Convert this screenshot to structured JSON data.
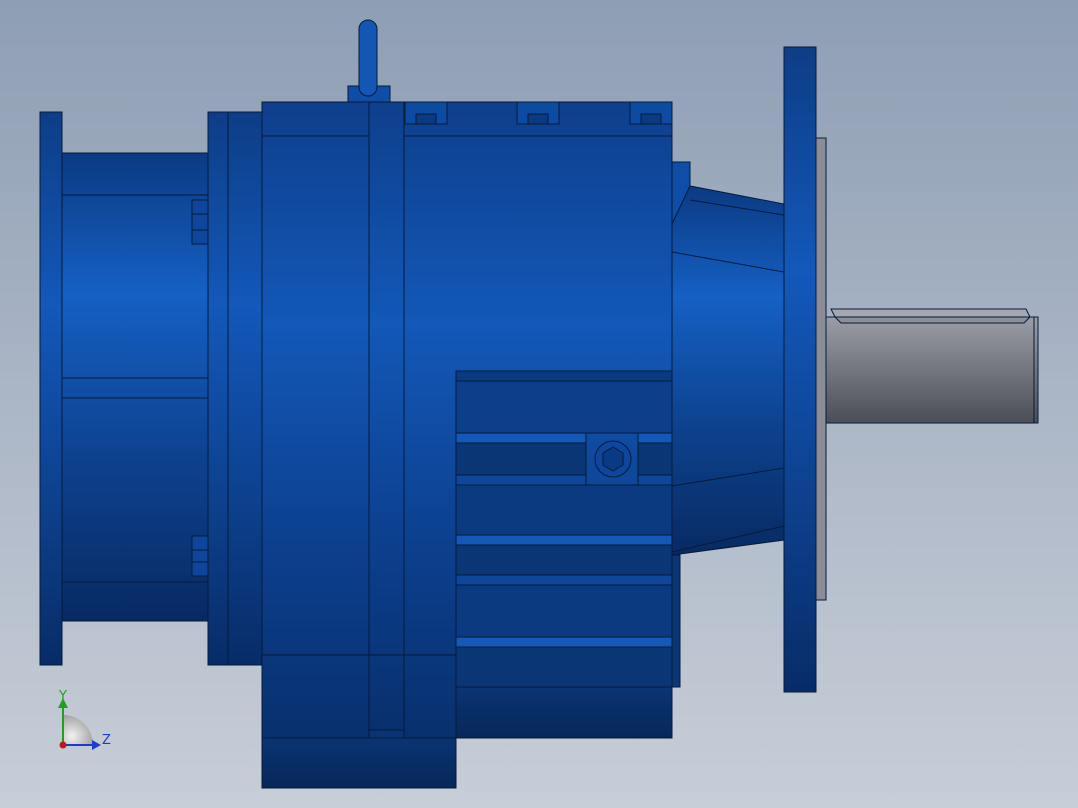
{
  "viewport": {
    "background_top": "#8e9eb4",
    "background_bottom": "#c8ced8"
  },
  "model": {
    "body_color": "#0f4fa8",
    "body_dark": "#0a3070",
    "shaft_color": "#7a7d86",
    "edge_color": "#061a3a"
  },
  "triad": {
    "y_label": "Y",
    "z_label": "Z",
    "y_color": "#20a020",
    "z_color": "#1a3ec8",
    "origin_color": "#c01818"
  }
}
